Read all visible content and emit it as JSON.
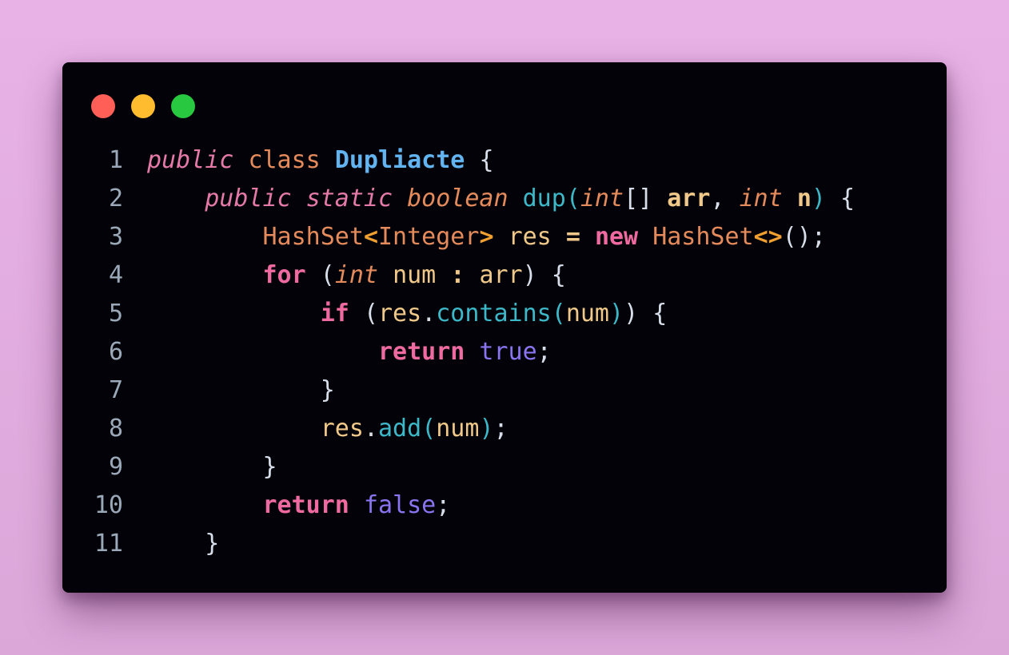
{
  "window": {
    "buttons": {
      "close": "close",
      "minimize": "minimize",
      "maximize": "maximize"
    }
  },
  "code": {
    "language": "java",
    "line_numbers": [
      "1",
      "2",
      "3",
      "4",
      "5",
      "6",
      "7",
      "8",
      "9",
      "10",
      "11"
    ],
    "tokens": {
      "l1_public": "public",
      "l1_class": "class",
      "l1_name": "Dupliacte",
      "l1_brace": "{",
      "l2_public": "public",
      "l2_static": "static",
      "l2_boolean": "boolean",
      "l2_fn": "dup",
      "l2_int1": "int",
      "l2_arr": "arr",
      "l2_int2": "int",
      "l2_n": "n",
      "l3_type": "HashSet",
      "l3_gen_open": "<",
      "l3_generic": "Integer",
      "l3_gen_close": ">",
      "l3_var": "res",
      "l3_eq": "=",
      "l3_new": "new",
      "l3_type2": "HashSet",
      "l3_diamond": "<>",
      "l3_end": "();",
      "l4_for": "for",
      "l4_int": "int",
      "l4_num": "num",
      "l4_colon": ":",
      "l4_arr": "arr",
      "l5_if": "if",
      "l5_res": "res",
      "l5_fn": "contains",
      "l5_num": "num",
      "l6_return": "return",
      "l6_true": "true",
      "l8_res": "res",
      "l8_fn": "add",
      "l8_num": "num",
      "l10_return": "return",
      "l10_false": "false"
    }
  }
}
